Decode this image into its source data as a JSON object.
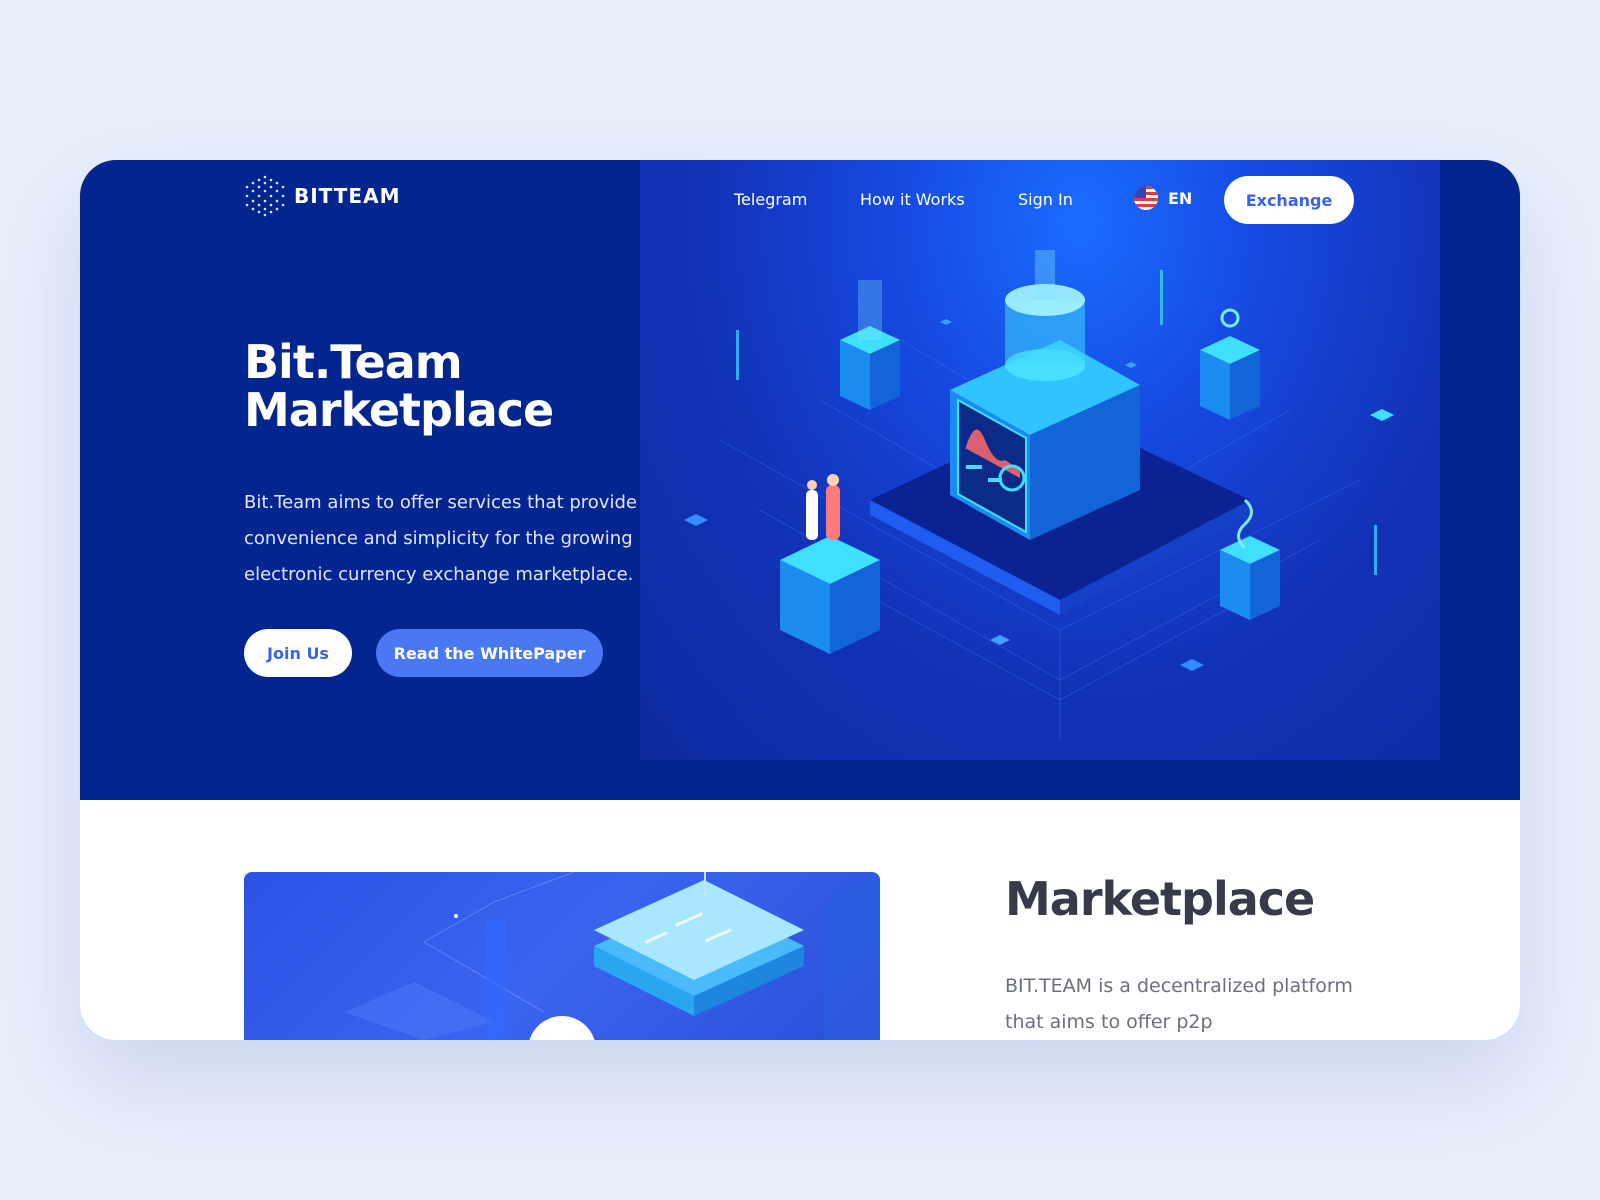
{
  "brand": {
    "name": "BITTEAM",
    "logo_icon": "hexagon-dots-icon"
  },
  "nav": {
    "links": [
      "Telegram",
      "How it Works",
      "Sign In"
    ],
    "language": "EN",
    "language_icon": "us-flag-icon",
    "exchange_label": "Exchange"
  },
  "hero": {
    "title_line1": "Bit.Team",
    "title_line2": "Marketplace",
    "description": "Bit.Team aims to offer services that provide convenience and simplicity for the growing electronic currency exchange marketplace.",
    "join_label": "Join Us",
    "whitepaper_label": "Read the WhitePaper",
    "illustration_icon": "isometric-data-center-illustration"
  },
  "marketplace": {
    "title": "Marketplace",
    "description": "BIT.TEAM is a decentralized platform that aims to offer p2p",
    "illustration_icon": "isometric-server-illustration",
    "play_icon": "play-icon"
  },
  "colors": {
    "page_bg": "#e8eefb",
    "hero_bg": "#032590",
    "accent": "#3b63e6",
    "secondary_button": "#4a78f2",
    "heading_dark": "#363a4b"
  }
}
